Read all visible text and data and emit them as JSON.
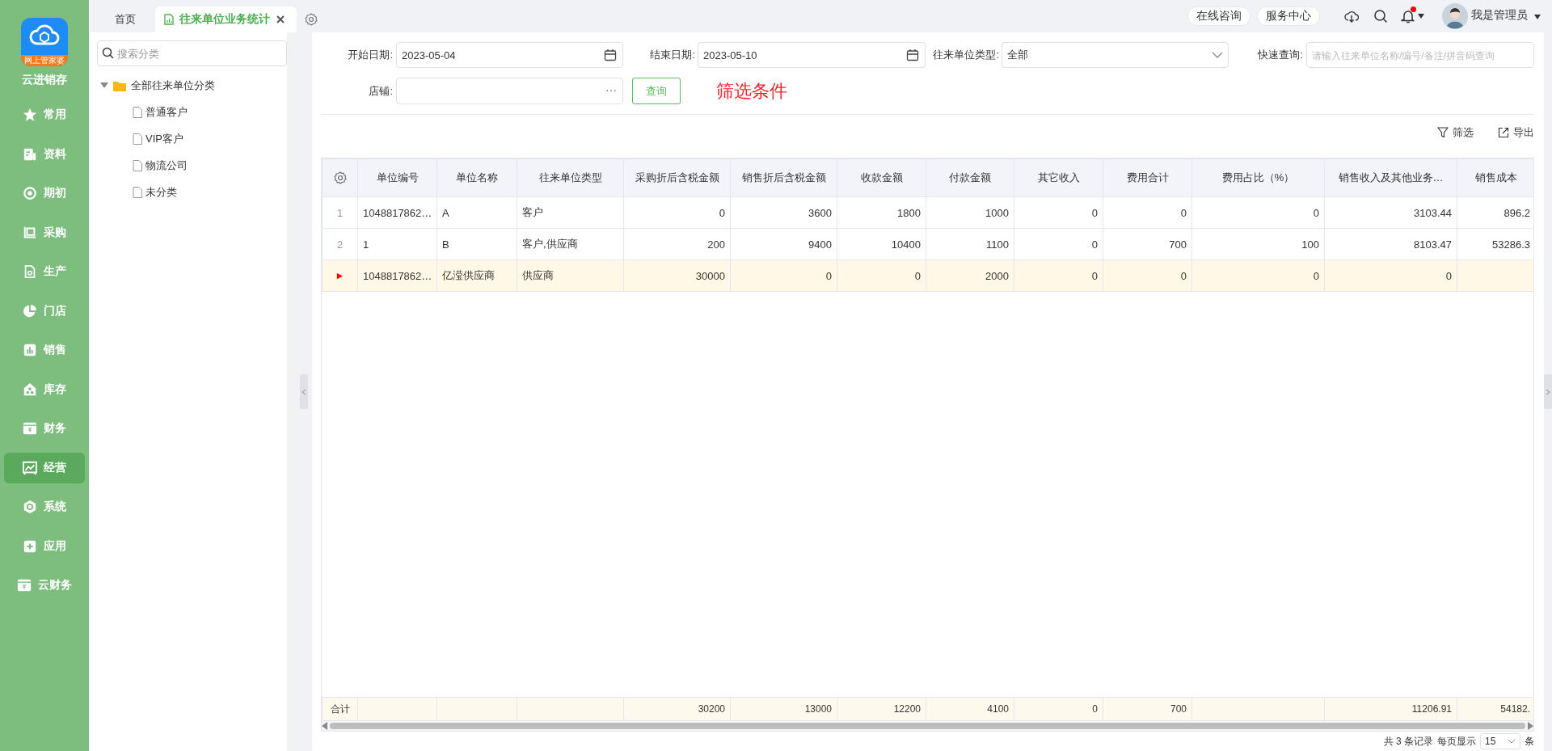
{
  "sidebar": {
    "logo": {
      "badge": "网上管家婆",
      "title": "云进销存"
    },
    "items": [
      {
        "label": "常用",
        "selected": false
      },
      {
        "label": "资料",
        "selected": false
      },
      {
        "label": "期初",
        "selected": false
      },
      {
        "label": "采购",
        "selected": false
      },
      {
        "label": "生产",
        "selected": false
      },
      {
        "label": "门店",
        "selected": false
      },
      {
        "label": "销售",
        "selected": false
      },
      {
        "label": "库存",
        "selected": false
      },
      {
        "label": "财务",
        "selected": false
      },
      {
        "label": "经营",
        "selected": true
      },
      {
        "label": "系统",
        "selected": false
      },
      {
        "label": "应用",
        "selected": false
      },
      {
        "label": "云财务",
        "selected": false
      }
    ]
  },
  "tabs": [
    {
      "label": "首页",
      "selected": false,
      "closable": false
    },
    {
      "label": "往来单位业务统计",
      "selected": true,
      "closable": true
    }
  ],
  "header": {
    "links": [
      "在线咨询",
      "服务中心"
    ],
    "notification_dot": true,
    "user": "我是管理员"
  },
  "tree": {
    "search_placeholder": "搜索分类",
    "root": {
      "label": "全部往来单位分类",
      "expanded": true,
      "children": [
        {
          "label": "普通客户"
        },
        {
          "label": "VIP客户"
        },
        {
          "label": "物流公司"
        },
        {
          "label": "未分类"
        }
      ]
    }
  },
  "filters": {
    "start_date": {
      "label": "开始日期:",
      "value": "2023-05-04"
    },
    "end_date": {
      "label": "结束日期:",
      "value": "2023-05-10"
    },
    "unit_type": {
      "label": "往来单位类型:",
      "value": "全部"
    },
    "quick_search": {
      "label": "快速查询:",
      "placeholder": "请输入往来单位名称/编号/备注/拼音码查询"
    },
    "store": {
      "label": "店铺:",
      "more_button": "···"
    },
    "query_button": "查询",
    "annotation": "筛选条件"
  },
  "toolbar": [
    "筛选",
    "导出"
  ],
  "table": {
    "columns": [
      "单位编号",
      "单位名称",
      "往来单位类型",
      "采购折后含税金额",
      "销售折后含税金额",
      "收款金额",
      "付款金额",
      "其它收入",
      "费用合计",
      "费用占比（%）",
      "销售收入及其他业务…",
      "销售成本"
    ],
    "rows": [
      {
        "index": "1",
        "selected": false,
        "cells": [
          "1048817862…",
          "A",
          "客户",
          "0",
          "3600",
          "1800",
          "1000",
          "0",
          "0",
          "0",
          "3103.44",
          "896.2"
        ]
      },
      {
        "index": "2",
        "selected": false,
        "cells": [
          "1",
          "B",
          "客户,供应商",
          "200",
          "9400",
          "10400",
          "1100",
          "0",
          "700",
          "100",
          "8103.47",
          "53286.3"
        ]
      },
      {
        "index": "►",
        "selected": true,
        "cells": [
          "1048817862…",
          "亿滢供应商",
          "供应商",
          "30000",
          "0",
          "0",
          "2000",
          "0",
          "0",
          "0",
          "0"
        ]
      }
    ],
    "summary": {
      "label": "合计",
      "purchase_amount": "30200",
      "sales_amount": "13000",
      "received_amount": "12200",
      "paid_amount": "4100",
      "other_income": "0",
      "expense_total": "700",
      "sales_income": "11206.91",
      "sales_cost": "54182."
    }
  },
  "pagination": {
    "total": "共 3 条记录",
    "page_size_label": "每页显示",
    "page_size": "15",
    "unit": "条"
  }
}
